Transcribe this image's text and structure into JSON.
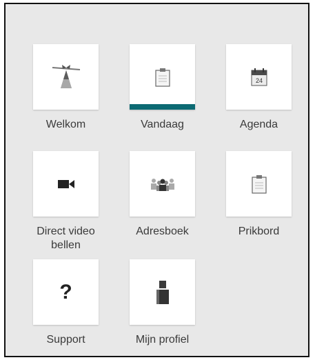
{
  "tiles": [
    {
      "label": "Welkom",
      "icon": "welcome-logo-icon",
      "active": false
    },
    {
      "label": "Vandaag",
      "icon": "clipboard-icon",
      "active": true
    },
    {
      "label": "Agenda",
      "icon": "calendar-icon",
      "calendar_day": "24",
      "active": false
    },
    {
      "label": "Direct video\nbellen",
      "icon": "video-camera-icon",
      "active": false
    },
    {
      "label": "Adresboek",
      "icon": "contacts-group-icon",
      "active": false
    },
    {
      "label": "Prikbord",
      "icon": "clipboard-icon",
      "active": false
    },
    {
      "label": "Support",
      "icon": "question-mark-icon",
      "question_glyph": "?",
      "active": false
    },
    {
      "label": "Mijn profiel",
      "icon": "person-icon",
      "active": false
    }
  ],
  "colors": {
    "accent": "#0c6a73",
    "panel_bg": "#e8e8e8",
    "card_bg": "#ffffff",
    "label_text": "#3a3a3a",
    "icon_gray": "#555555"
  }
}
